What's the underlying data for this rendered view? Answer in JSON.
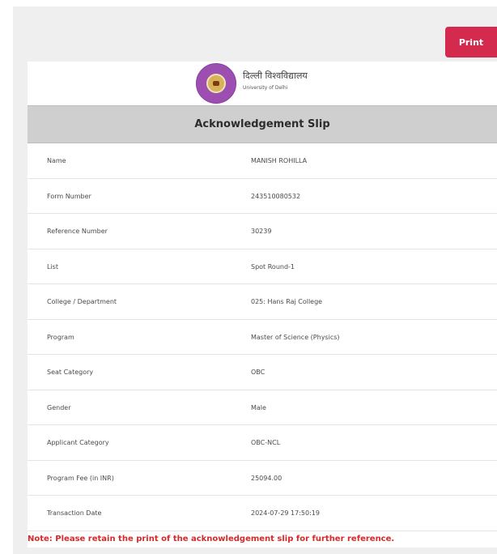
{
  "toolbar": {
    "print_label": "Print"
  },
  "header": {
    "university_hindi": "दिल्ली विश्वविद्यालय",
    "university_english": "University of Delhi",
    "logo_icon": "university-seal-icon"
  },
  "slip": {
    "title": "Acknowledgement Slip",
    "rows": [
      {
        "label": "Name",
        "value": "MANISH ROHILLA"
      },
      {
        "label": "Form Number",
        "value": "243510080532"
      },
      {
        "label": "Reference Number",
        "value": "30239"
      },
      {
        "label": "List",
        "value": "Spot Round-1"
      },
      {
        "label": "College / Department",
        "value": "025: Hans Raj College"
      },
      {
        "label": "Program",
        "value": "Master of Science (Physics)"
      },
      {
        "label": "Seat Category",
        "value": "OBC"
      },
      {
        "label": "Gender",
        "value": "Male"
      },
      {
        "label": "Applicant Category",
        "value": "OBC-NCL"
      },
      {
        "label": "Program Fee (in INR)",
        "value": "25094.00"
      },
      {
        "label": "Transaction Date",
        "value": "2024-07-29 17:50:19"
      }
    ]
  },
  "footer": {
    "note": "Note: Please retain the print of the acknowledgement slip for further reference."
  },
  "colors": {
    "accent": "#d42a4e",
    "note": "#d42a2a",
    "title_bar": "#cfcfcf",
    "logo": "#9c4fb1"
  }
}
